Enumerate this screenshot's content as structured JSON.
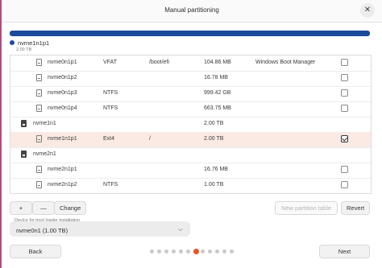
{
  "window": {
    "title": "Manual partitioning"
  },
  "colors": {
    "disk_bar": "#1a4a9a",
    "accent": "#e95420",
    "selected_row": "#fbeae4"
  },
  "disk": {
    "name": "nvme1n1p1",
    "size": "2.00 TB"
  },
  "partitions": [
    {
      "device": "nvme0n1p1",
      "type": "VFAT",
      "mount": "/boot/efi",
      "size": "104.86 MB",
      "system": "Windows Boot Manager",
      "format": false,
      "is_disk": false
    },
    {
      "device": "nvme0n1p2",
      "type": "",
      "mount": "",
      "size": "16.78 MB",
      "system": "",
      "format": false,
      "is_disk": false
    },
    {
      "device": "nvme0n1p3",
      "type": "NTFS",
      "mount": "",
      "size": "999.42 GB",
      "system": "",
      "format": false,
      "is_disk": false
    },
    {
      "device": "nvme0n1p4",
      "type": "NTFS",
      "mount": "",
      "size": "663.75 MB",
      "system": "",
      "format": false,
      "is_disk": false
    },
    {
      "device": "nvme1n1",
      "type": "",
      "mount": "",
      "size": "2.00 TB",
      "system": "",
      "format": null,
      "is_disk": true
    },
    {
      "device": "nvme1n1p1",
      "type": "Ext4",
      "mount": "/",
      "size": "2.00 TB",
      "system": "",
      "format": true,
      "is_disk": false,
      "selected": true
    },
    {
      "device": "nvme2n1",
      "type": "",
      "mount": "",
      "size": "",
      "system": "",
      "format": null,
      "is_disk": true
    },
    {
      "device": "nvme2n1p1",
      "type": "",
      "mount": "",
      "size": "16.76 MB",
      "system": "",
      "format": false,
      "is_disk": false
    },
    {
      "device": "nvme2n1p2",
      "type": "NTFS",
      "mount": "",
      "size": "1.00 TB",
      "system": "",
      "format": false,
      "is_disk": false
    }
  ],
  "toolbar": {
    "add": "+",
    "remove": "—",
    "change": "Change",
    "new_table": "New partition table",
    "revert": "Revert"
  },
  "bootloader": {
    "label": "Device for boot loader installation",
    "value": "nvme0n1 (1.00 TB)"
  },
  "nav": {
    "back": "Back",
    "next": "Next"
  },
  "pagination": {
    "total": 12,
    "current": 7
  }
}
